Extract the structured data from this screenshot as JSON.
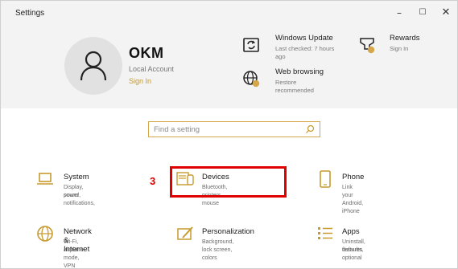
{
  "window": {
    "title": "Settings"
  },
  "controls": {
    "minimize": "–",
    "maximize": "☐",
    "close": "✕"
  },
  "user": {
    "name": "OKM",
    "account_type": "Local Account",
    "sign_in": "Sign In"
  },
  "header_items": [
    {
      "icon": "windows-update-icon",
      "title": "Windows Update",
      "sub": [
        "Last checked: 7 hours",
        "ago"
      ]
    },
    {
      "icon": "web-browsing-icon",
      "title": "Web browsing",
      "sub": [
        "Restore",
        "recommended"
      ]
    },
    {
      "icon": "rewards-icon",
      "title": "Rewards",
      "sub": [
        "Sign In"
      ]
    }
  ],
  "search": {
    "placeholder": "Find a setting"
  },
  "annotation": {
    "step": "3",
    "color": "#e00000"
  },
  "tiles": [
    {
      "icon": "laptop-icon",
      "title": "System",
      "desc": [
        "Display, sound, notifications,",
        "power"
      ]
    },
    {
      "icon": "devices-icon",
      "title": "Devices",
      "desc": [
        "Bluetooth, printers, mouse"
      ]
    },
    {
      "icon": "phone-icon",
      "title": "Phone",
      "desc": [
        "Link your Android, iPhone"
      ]
    },
    {
      "icon": "globe-icon",
      "title": "Network & Internet",
      "desc": [
        "Wi-Fi, airplane mode, VPN"
      ]
    },
    {
      "icon": "personalization-icon",
      "title": "Personalization",
      "desc": [
        "Background, lock screen, colors"
      ]
    },
    {
      "icon": "apps-icon",
      "title": "Apps",
      "desc": [
        "Uninstall, defaults, optional",
        "features"
      ]
    }
  ],
  "colors": {
    "accent": "#d5a64a",
    "header_bg": "#f3f3f3",
    "sign_in": "#c79a2e"
  }
}
